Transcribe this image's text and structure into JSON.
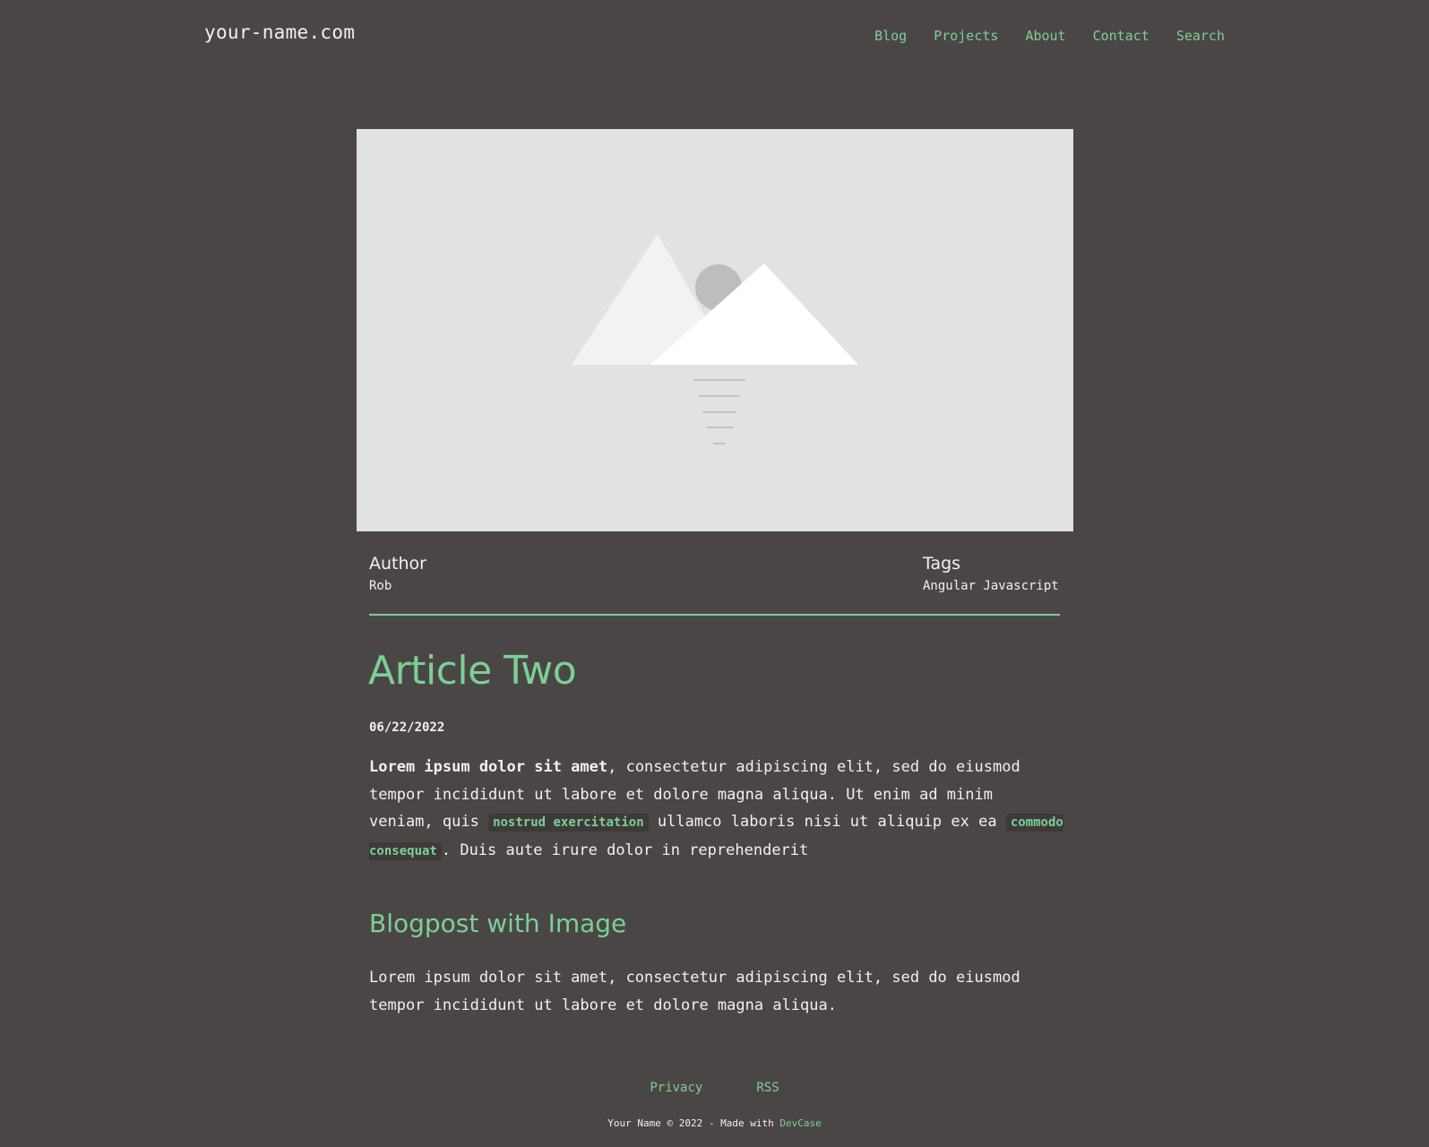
{
  "header": {
    "site_title": "your-name.com",
    "nav": [
      "Blog",
      "Projects",
      "About",
      "Contact",
      "Search"
    ]
  },
  "hero": {
    "icon": "image-placeholder-icon"
  },
  "meta": {
    "author_label": "Author",
    "author": "Rob",
    "tags_label": "Tags",
    "tags": "Angular Javascript"
  },
  "article": {
    "title": "Article Two",
    "date": "06/22/2022",
    "p1": {
      "bold": "Lorem ipsum dolor sit amet",
      "text1": ", consectetur adipiscing elit, sed do eiusmod tempor incididunt ut labore et dolore magna aliqua. Ut enim ad minim veniam, quis ",
      "code1": "nostrud exercitation",
      "text2": " ullamco laboris nisi ut aliquip ex ea ",
      "code2": "commodo consequat",
      "text3": ". Duis aute irure dolor in reprehenderit"
    },
    "subheading": "Blogpost with Image",
    "p2": "Lorem ipsum dolor sit amet, consectetur adipiscing elit, sed do eiusmod tempor incididunt ut labore et dolore magna aliqua."
  },
  "footer": {
    "links": [
      "Privacy",
      "RSS"
    ],
    "copyright": "Your Name © 2022 - Made with ",
    "made_with": "DevCase"
  },
  "colors": {
    "background": "#4b4646",
    "accent": "#7ccf96",
    "text": "#f2f0f0"
  }
}
